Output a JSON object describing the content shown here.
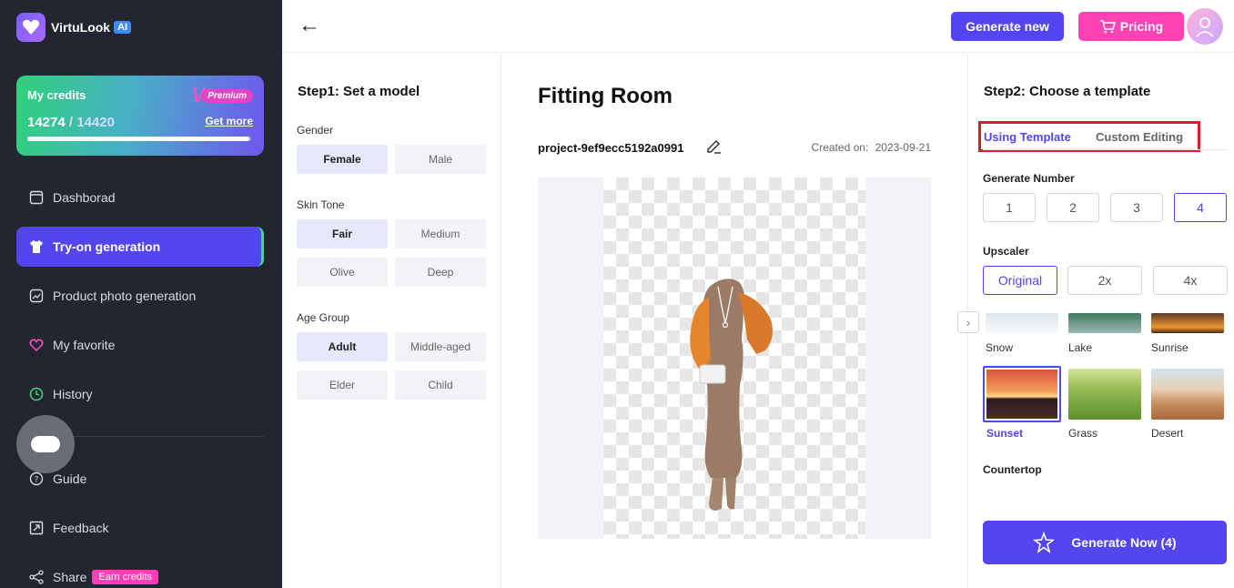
{
  "app": {
    "name": "VirtuLook",
    "badge": "AI"
  },
  "credits": {
    "title": "My credits",
    "used": "14274",
    "separator": " / ",
    "total": "14420",
    "get_more": "Get more",
    "premium": "Premium",
    "fill_fraction": 0.99
  },
  "sidebar": {
    "items": [
      {
        "label": "Dashborad",
        "icon": "dashboard-icon"
      },
      {
        "label": "Try-on generation",
        "icon": "shirt-icon"
      },
      {
        "label": "Product photo generation",
        "icon": "image-icon"
      },
      {
        "label": "My favorite",
        "icon": "heart-icon"
      },
      {
        "label": "History",
        "icon": "history-icon"
      },
      {
        "label": "Guide",
        "icon": "help-icon"
      },
      {
        "label": "Feedback",
        "icon": "feedback-icon"
      },
      {
        "label": "Share",
        "icon": "share-icon"
      }
    ],
    "earn_credits": "Earn credits"
  },
  "topbar": {
    "generate_new": "Generate new",
    "pricing": "Pricing"
  },
  "step1": {
    "title": "Step1: Set a model",
    "gender": {
      "label": "Gender",
      "options": [
        "Female",
        "Male"
      ],
      "selected": "Female"
    },
    "skin_tone": {
      "label": "Skin Tone",
      "options": [
        "Fair",
        "Medium",
        "Olive",
        "Deep"
      ],
      "selected": "Fair"
    },
    "age_group": {
      "label": "Age Group",
      "options": [
        "Adult",
        "Middle-aged",
        "Elder",
        "Child"
      ],
      "selected": "Adult"
    }
  },
  "center": {
    "title": "Fitting Room",
    "project": "project-9ef9ecc5192a0991",
    "created_label": "Created on:",
    "created_date": "2023-09-21"
  },
  "step2": {
    "title": "Step2: Choose a template",
    "tabs": [
      "Using Template",
      "Custom Editing"
    ],
    "generate_number": {
      "label": "Generate Number",
      "options": [
        "1",
        "2",
        "3",
        "4"
      ],
      "selected": "4"
    },
    "upscaler": {
      "label": "Upscaler",
      "options": [
        "Original",
        "2x",
        "4x"
      ],
      "selected": "Original"
    },
    "templates_row1": [
      "Snow",
      "Lake",
      "Sunrise"
    ],
    "templates_row2": [
      "Sunset",
      "Grass",
      "Desert"
    ],
    "selected_template": "Sunset",
    "next_section": "Countertop",
    "generate_now": "Generate Now (4)"
  },
  "colors": {
    "accent": "#5346f0",
    "pink": "#ff43b5",
    "sidebar_bg": "#232530",
    "highlight_box": "#d6202d"
  }
}
